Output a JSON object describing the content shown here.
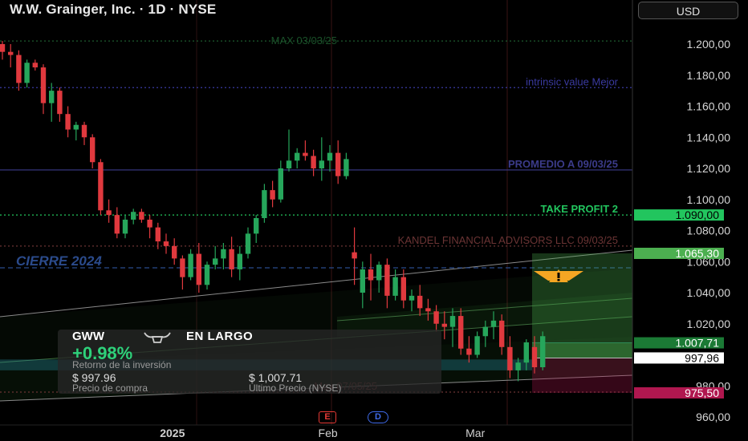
{
  "header": {
    "title": "W.W. Grainger, Inc. · 1D · NYSE",
    "currency_label": "USD"
  },
  "chart_data": {
    "type": "candlestick",
    "ylim": [
      955,
      1210
    ],
    "y_ticks": [
      {
        "value": 1200,
        "label": "1.200,00"
      },
      {
        "value": 1180,
        "label": "1.180,00"
      },
      {
        "value": 1160,
        "label": "1.160,00"
      },
      {
        "value": 1140,
        "label": "1.140,00"
      },
      {
        "value": 1120,
        "label": "1.120,00"
      },
      {
        "value": 1100,
        "label": "1.100,00"
      },
      {
        "value": 1080,
        "label": "1.080,00"
      },
      {
        "value": 1060,
        "label": "1.060,00"
      },
      {
        "value": 1040,
        "label": "1.040,00"
      },
      {
        "value": 1020,
        "label": "1.020,00"
      },
      {
        "value": 980,
        "label": "980,00"
      },
      {
        "value": 960,
        "label": "960,00"
      }
    ],
    "x_labels": [
      {
        "label": "2025",
        "index": 19
      },
      {
        "label": "Feb",
        "index": 38
      },
      {
        "label": "Mar",
        "index": 56
      }
    ],
    "price_tags": [
      {
        "value": 1090,
        "label": "1.090,00",
        "bg": "#22c55e",
        "fg": "#000000"
      },
      {
        "value": 1065.3,
        "label": "1.065,30",
        "bg": "#4caf50",
        "fg": "#ffffff"
      },
      {
        "value": 1007.71,
        "label": "1.007,71",
        "bg": "#1b7a35",
        "fg": "#ffffff"
      },
      {
        "value": 997.96,
        "label": "997,96",
        "bg": "#ffffff",
        "fg": "#000000"
      },
      {
        "value": 975.5,
        "label": "975,50",
        "bg": "#b0174f",
        "fg": "#ffffff"
      }
    ],
    "levels": [
      {
        "value": 1202,
        "label": "MAX 03/03/25",
        "color": "#1d5a2e",
        "style": "dotted"
      },
      {
        "value": 1172,
        "label": "intrinsic value Mejor",
        "color": "#3a3aa0",
        "style": "dotted"
      },
      {
        "value": 1119,
        "label": "PROMEDIO A 09/03/25",
        "color": "#3b3b8a",
        "style": "solid"
      },
      {
        "value": 1090,
        "label": "TAKE PROFIT 2",
        "color": "#22c55e",
        "style": "dotted"
      },
      {
        "value": 1070,
        "label": "KANDEL FINANCIAL ADVISORS LLC  09/03/25",
        "color": "#6b3434",
        "style": "dotted"
      },
      {
        "value": 1056,
        "label": "CIERRE 2024",
        "color": "#2b4b8c",
        "style": "dashed"
      },
      {
        "value": 976,
        "label": "Max 07/05/25",
        "color": "#6b3434",
        "style": "dotted"
      }
    ],
    "events": [
      {
        "label": "E",
        "index": 39
      },
      {
        "label": "D",
        "index": 45
      }
    ],
    "position": {
      "ticker": "GWW",
      "side": "EN LARGO",
      "return": "+0.98%",
      "return_label": "Retorno de la inversión",
      "buy_price": "$ 997.96",
      "buy_label": "Precio de compra",
      "last_price": "$ 1,007.71",
      "last_label": "Último Precio (NYSE)"
    },
    "ohlc": [
      [
        1200,
        1202,
        1190,
        1195
      ],
      [
        1195,
        1200,
        1185,
        1193
      ],
      [
        1193,
        1196,
        1170,
        1175
      ],
      [
        1175,
        1190,
        1172,
        1188
      ],
      [
        1188,
        1190,
        1183,
        1185
      ],
      [
        1185,
        1187,
        1155,
        1162
      ],
      [
        1162,
        1175,
        1150,
        1170
      ],
      [
        1170,
        1172,
        1150,
        1155
      ],
      [
        1155,
        1160,
        1140,
        1145
      ],
      [
        1145,
        1150,
        1138,
        1148
      ],
      [
        1148,
        1150,
        1135,
        1140
      ],
      [
        1140,
        1142,
        1120,
        1124
      ],
      [
        1124,
        1126,
        1090,
        1093
      ],
      [
        1093,
        1100,
        1085,
        1090
      ],
      [
        1090,
        1095,
        1075,
        1078
      ],
      [
        1078,
        1090,
        1075,
        1087
      ],
      [
        1087,
        1094,
        1084,
        1092
      ],
      [
        1092,
        1094,
        1085,
        1087
      ],
      [
        1087,
        1090,
        1075,
        1082
      ],
      [
        1082,
        1085,
        1068,
        1073
      ],
      [
        1073,
        1078,
        1065,
        1070
      ],
      [
        1070,
        1075,
        1058,
        1062
      ],
      [
        1062,
        1064,
        1042,
        1050
      ],
      [
        1050,
        1068,
        1048,
        1065
      ],
      [
        1065,
        1072,
        1040,
        1045
      ],
      [
        1045,
        1060,
        1042,
        1058
      ],
      [
        1058,
        1070,
        1055,
        1062
      ],
      [
        1062,
        1072,
        1055,
        1068
      ],
      [
        1068,
        1076,
        1050,
        1055
      ],
      [
        1055,
        1070,
        1048,
        1065
      ],
      [
        1065,
        1082,
        1062,
        1078
      ],
      [
        1078,
        1090,
        1072,
        1088
      ],
      [
        1088,
        1110,
        1085,
        1106
      ],
      [
        1106,
        1112,
        1095,
        1100
      ],
      [
        1100,
        1125,
        1098,
        1120
      ],
      [
        1120,
        1145,
        1118,
        1125
      ],
      [
        1125,
        1133,
        1120,
        1130
      ],
      [
        1130,
        1138,
        1125,
        1128
      ],
      [
        1128,
        1132,
        1115,
        1120
      ],
      [
        1120,
        1140,
        1112,
        1125
      ],
      [
        1125,
        1135,
        1118,
        1130
      ],
      [
        1130,
        1138,
        1110,
        1115
      ],
      [
        1115,
        1130,
        1113,
        1126
      ],
      [
        1066,
        1082,
        1045,
        1062
      ],
      [
        1040,
        1060,
        1030,
        1055
      ],
      [
        1055,
        1065,
        1035,
        1048
      ],
      [
        1048,
        1060,
        1040,
        1058
      ],
      [
        1058,
        1062,
        1030,
        1038
      ],
      [
        1038,
        1055,
        1035,
        1050
      ],
      [
        1050,
        1055,
        1030,
        1035
      ],
      [
        1035,
        1042,
        1028,
        1038
      ],
      [
        1038,
        1045,
        1025,
        1030
      ],
      [
        1030,
        1036,
        1022,
        1028
      ],
      [
        1028,
        1032,
        1015,
        1020
      ],
      [
        1020,
        1028,
        1010,
        1018
      ],
      [
        1018,
        1030,
        1005,
        1025
      ],
      [
        1025,
        1030,
        1000,
        1004
      ],
      [
        1004,
        1012,
        995,
        1000
      ],
      [
        1000,
        1015,
        998,
        1012
      ],
      [
        1012,
        1022,
        1005,
        1018
      ],
      [
        1018,
        1028,
        1010,
        1022
      ],
      [
        1022,
        1026,
        1000,
        1005
      ],
      [
        1005,
        1012,
        985,
        990
      ],
      [
        990,
        998,
        983,
        995
      ],
      [
        995,
        1010,
        990,
        1008
      ],
      [
        1005,
        1012,
        988,
        992
      ],
      [
        992,
        1015,
        990,
        1012
      ]
    ]
  }
}
